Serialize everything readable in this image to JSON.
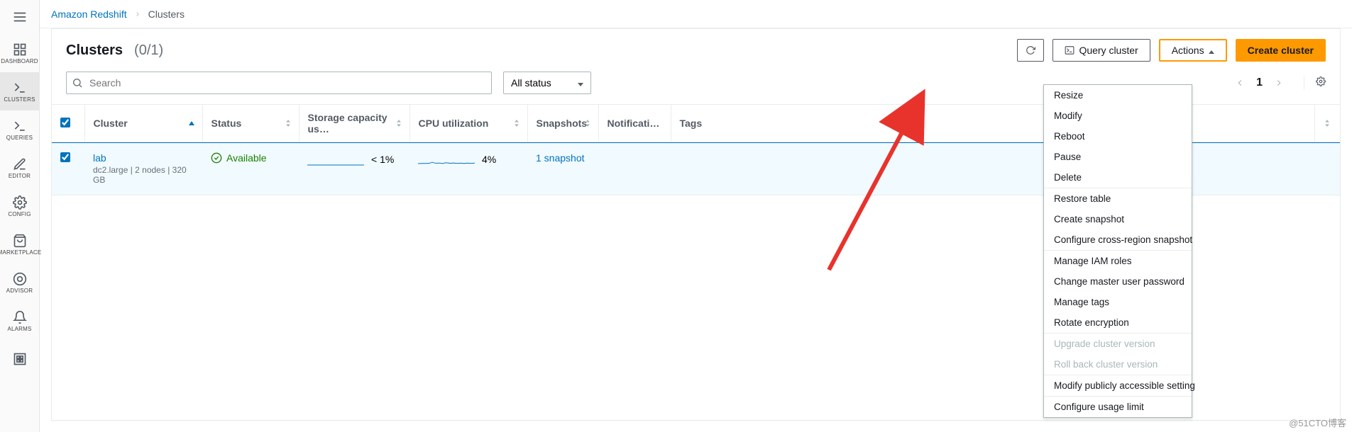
{
  "sidebar": {
    "items": [
      {
        "key": "dashboard",
        "label": "DASHBOARD"
      },
      {
        "key": "clusters",
        "label": "CLUSTERS"
      },
      {
        "key": "queries",
        "label": "QUERIES"
      },
      {
        "key": "editor",
        "label": "EDITOR"
      },
      {
        "key": "config",
        "label": "CONFIG"
      },
      {
        "key": "marketplace",
        "label": "MARKETPLACE"
      },
      {
        "key": "advisor",
        "label": "ADVISOR"
      },
      {
        "key": "alarms",
        "label": "ALARMS"
      }
    ]
  },
  "breadcrumbs": {
    "root": "Amazon Redshift",
    "current": "Clusters"
  },
  "header": {
    "title": "Clusters",
    "count": "(0/1)",
    "buttons": {
      "query_cluster": "Query cluster",
      "actions": "Actions",
      "create_cluster": "Create cluster"
    }
  },
  "filter": {
    "search_placeholder": "Search",
    "status_filter": "All status",
    "page": "1"
  },
  "table": {
    "columns": {
      "cluster": "Cluster",
      "status": "Status",
      "storage": "Storage capacity us…",
      "cpu": "CPU utilization",
      "snapshots": "Snapshots",
      "notifications": "Notificati…",
      "tags": "Tags"
    },
    "rows": [
      {
        "name": "lab",
        "subtype": "dc2.large | 2 nodes | 320 GB",
        "status": "Available",
        "storage_pct": "< 1%",
        "cpu_pct": "4%",
        "snapshot_link": "1 snapshot"
      }
    ]
  },
  "actions_menu": {
    "groups": [
      [
        "Resize",
        "Modify",
        "Reboot",
        "Pause",
        "Delete"
      ],
      [
        "Restore table",
        "Create snapshot",
        "Configure cross-region snapshot"
      ],
      [
        "Manage IAM roles",
        "Change master user password",
        "Manage tags",
        "Rotate encryption"
      ],
      [
        "Upgrade cluster version",
        "Roll back cluster version"
      ],
      [
        "Modify publicly accessible setting"
      ],
      [
        "Configure usage limit"
      ]
    ],
    "disabled": [
      "Upgrade cluster version",
      "Roll back cluster version"
    ]
  },
  "watermark": "@51CTO博客"
}
